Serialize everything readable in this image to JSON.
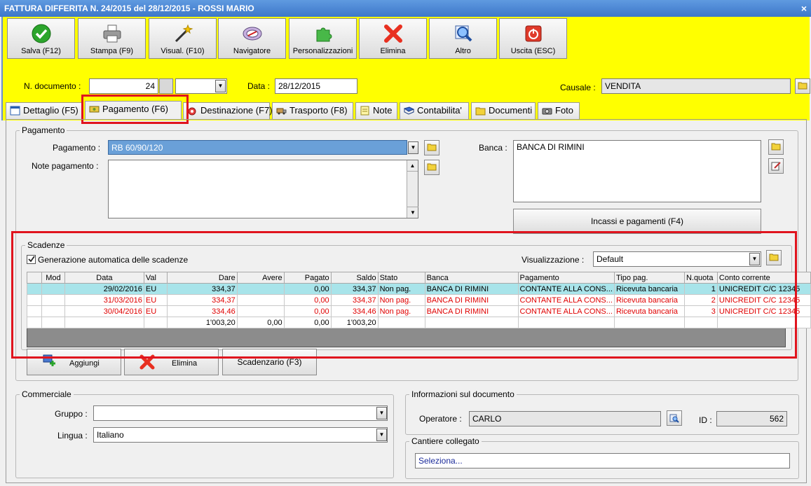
{
  "window": {
    "title": "FATTURA DIFFERITA N. 24/2015 del 28/12/2015 - ROSSI MARIO",
    "close": "×"
  },
  "toolbar": [
    {
      "label": "Salva (F12)",
      "icon": "save-check-icon"
    },
    {
      "label": "Stampa (F9)",
      "icon": "printer-icon"
    },
    {
      "label": "Visual. (F10)",
      "icon": "magic-wand-icon"
    },
    {
      "label": "Navigatore",
      "icon": "compass-icon"
    },
    {
      "label": "Personalizzazioni",
      "icon": "puzzle-icon"
    },
    {
      "label": "Elimina",
      "icon": "delete-x-icon"
    },
    {
      "label": "Altro",
      "icon": "magnifier-icon"
    },
    {
      "label": "Uscita (ESC)",
      "icon": "power-icon"
    }
  ],
  "header": {
    "doc_label": "N. documento :",
    "doc_number": "24",
    "date_label": "Data :",
    "date_value": "28/12/2015",
    "causale_label": "Causale :",
    "causale_value": "VENDITA"
  },
  "tabs": [
    {
      "label": "Dettaglio (F5)"
    },
    {
      "label": "Pagamento (F6)"
    },
    {
      "label": "Destinazione (F7)"
    },
    {
      "label": "Trasporto (F8)"
    },
    {
      "label": "Note"
    },
    {
      "label": "Contabilita'"
    },
    {
      "label": "Documenti"
    },
    {
      "label": "Foto"
    }
  ],
  "pagamento": {
    "group_title": "Pagamento",
    "pagamento_label": "Pagamento :",
    "pagamento_value": "RB 60/90/120",
    "note_label": "Note pagamento :",
    "banca_label": "Banca :",
    "banca_value": "BANCA DI RIMINI",
    "incassi_button": "Incassi e pagamenti (F4)"
  },
  "scadenze": {
    "group_title": "Scadenze",
    "auto_label": "Generazione automatica delle scadenze",
    "visual_label": "Visualizzazione :",
    "visual_value": "Default",
    "columns": [
      "Mod",
      "Data",
      "Val",
      "Dare",
      "Avere",
      "Pagato",
      "Saldo",
      "Stato",
      "Banca",
      "Pagamento",
      "Tipo pag.",
      "N.quota",
      "Conto corrente"
    ],
    "rows": [
      [
        "",
        "29/02/2016",
        "EU",
        "334,37",
        "",
        "0,00",
        "334,37",
        "Non pag.",
        "BANCA DI RIMINI",
        "CONTANTE ALLA CONS...",
        "Ricevuta bancaria",
        "1",
        "UNICREDIT C/C 12345"
      ],
      [
        "",
        "31/03/2016",
        "EU",
        "334,37",
        "",
        "0,00",
        "334,37",
        "Non pag.",
        "BANCA DI RIMINI",
        "CONTANTE ALLA CONS...",
        "Ricevuta bancaria",
        "2",
        "UNICREDIT C/C 12345"
      ],
      [
        "",
        "30/04/2016",
        "EU",
        "334,46",
        "",
        "0,00",
        "334,46",
        "Non pag.",
        "BANCA DI RIMINI",
        "CONTANTE ALLA CONS...",
        "Ricevuta bancaria",
        "3",
        "UNICREDIT C/C 12345"
      ]
    ],
    "totals": [
      "",
      "",
      "",
      "1'003,20",
      "0,00",
      "0,00",
      "1'003,20",
      "",
      "",
      "",
      "",
      "",
      ""
    ],
    "add_button": "Aggiungi",
    "delete_button": "Elimina",
    "scadenzario_button": "Scadenzario (F3)"
  },
  "commerciale": {
    "group_title": "Commerciale",
    "gruppo_label": "Gruppo :",
    "gruppo_value": "",
    "lingua_label": "Lingua :",
    "lingua_value": "Italiano"
  },
  "info": {
    "group_title": "Informazioni sul documento",
    "operatore_label": "Operatore :",
    "operatore_value": "CARLO",
    "id_label": "ID :",
    "id_value": "562"
  },
  "cantiere": {
    "group_title": "Cantiere collegato",
    "placeholder": "Seleziona..."
  }
}
